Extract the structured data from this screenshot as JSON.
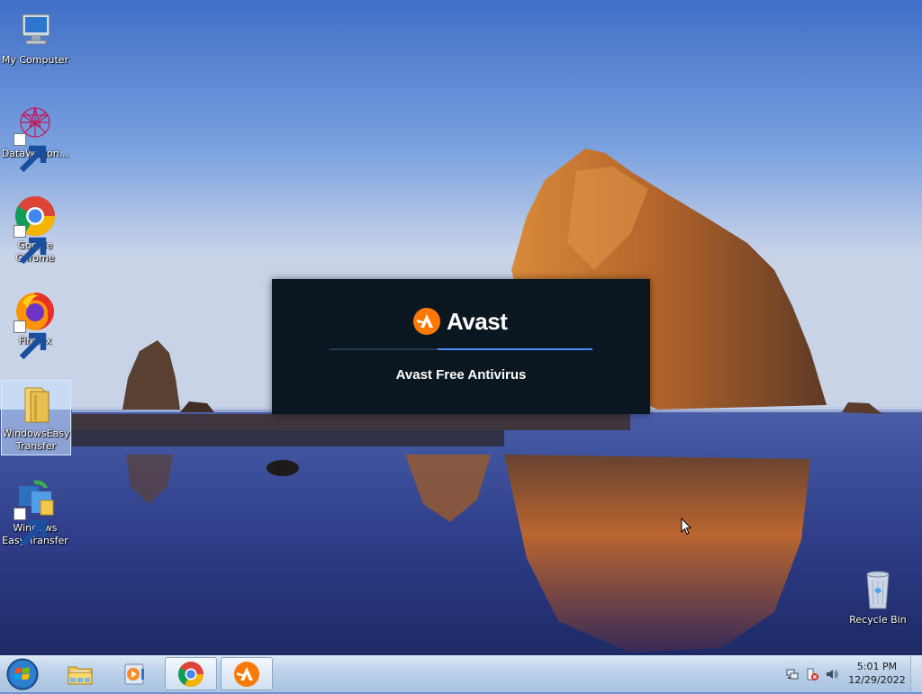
{
  "desktop": {
    "icons": [
      {
        "label": "My Computer"
      },
      {
        "label": "DataWagon..."
      },
      {
        "label": "Google Chrome"
      },
      {
        "label": "Firefox"
      },
      {
        "label": "WindowsEasy Transfer"
      },
      {
        "label": "Windows Easy Transfer"
      },
      {
        "label": "Recycle Bin"
      }
    ]
  },
  "splash": {
    "brand": "Avast",
    "product": "Avast Free Antivirus",
    "progress": 0.59,
    "brand_color": "#ff7800",
    "bg_color": "#0a1721",
    "progress_color": "#4a8cff"
  },
  "taskbar": {
    "start_icon": "windows-orb-icon",
    "pinned": [
      {
        "name": "file-explorer-icon"
      },
      {
        "name": "media-player-icon"
      },
      {
        "name": "chrome-icon",
        "active": true
      },
      {
        "name": "avast-icon",
        "active": true
      }
    ],
    "tray_icons": [
      "network-icon",
      "action-center-icon",
      "volume-icon"
    ],
    "clock": {
      "time": "5:01 PM",
      "date": "12/29/2022"
    }
  }
}
